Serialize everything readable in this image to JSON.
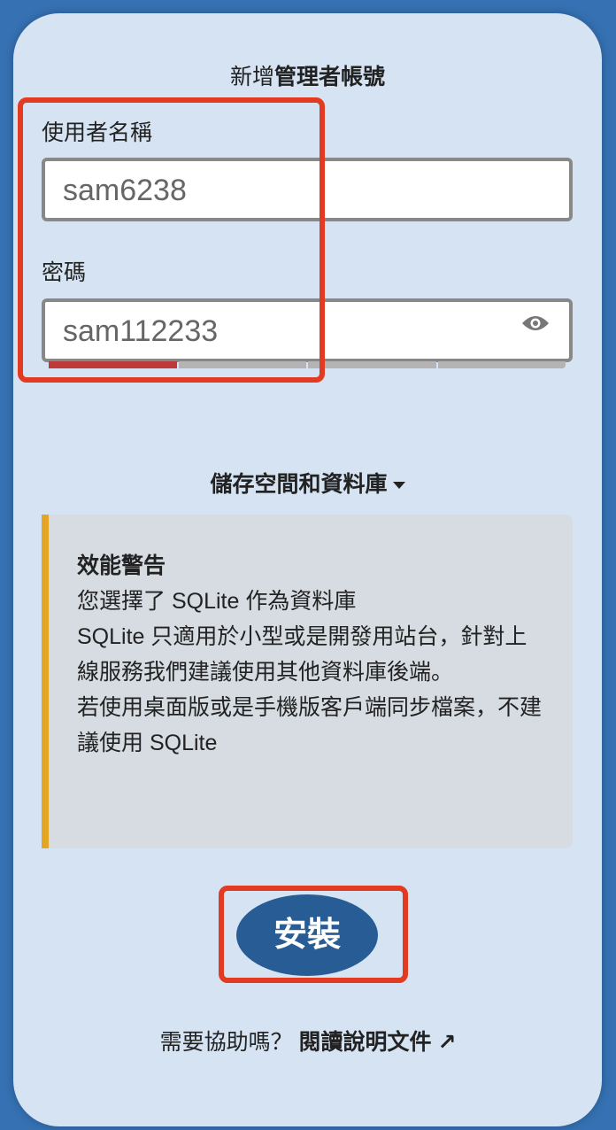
{
  "form": {
    "title_prefix": "新增",
    "title_bold": "管理者帳號",
    "username_label": "使用者名稱",
    "username_value": "sam6238",
    "password_label": "密碼",
    "password_value": "sam112233",
    "password_strength_fraction": 0.25,
    "show_password_icon": "eye-icon"
  },
  "storage_toggle": {
    "label": "儲存空間和資料庫",
    "icon": "caret-down-icon"
  },
  "warning": {
    "title": "效能警告",
    "lines": [
      "您選擇了 SQLite 作為資料庫",
      "SQLite 只適用於小型或是開發用站台，針對上線服務我們建議使用其他資料庫後端。",
      "若使用桌面版或是手機版客戶端同步檔案，不建議使用 SQLite"
    ]
  },
  "install_button": "安裝",
  "help": {
    "text": "需要協助嗎？",
    "link": "閱讀說明文件 ↗"
  },
  "colors": {
    "background": "#3571b3",
    "card": "#d5e3f3",
    "primary": "#285c95",
    "warning_border": "#e4a523",
    "strength_weak": "#c0393a",
    "annotation": "#e33a22"
  }
}
